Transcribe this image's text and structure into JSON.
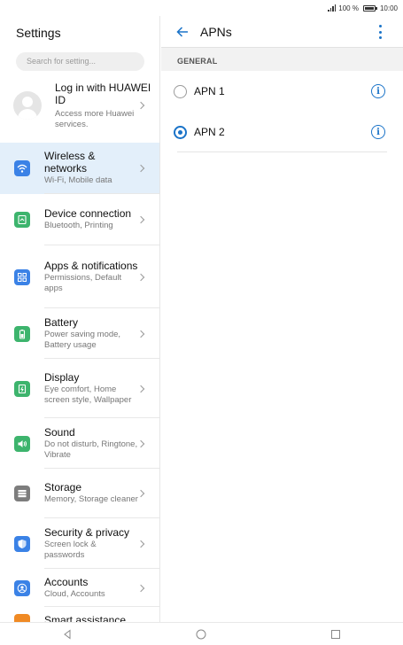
{
  "status_bar": {
    "battery_percent": "100 %",
    "time": "10:00"
  },
  "left_panel": {
    "title": "Settings",
    "search_placeholder": "Search for setting...",
    "account": {
      "title": "Log in with HUAWEI ID",
      "subtitle": "Access more Huawei services."
    },
    "items": [
      {
        "title": "Wireless & networks",
        "subtitle": "Wi-Fi, Mobile data",
        "icon": "wifi-icon",
        "color": "#3b82e6"
      },
      {
        "title": "Device connection",
        "subtitle": "Bluetooth, Printing",
        "icon": "device-connection-icon",
        "color": "#3db46d"
      },
      {
        "title": "Apps & notifications",
        "subtitle": "Permissions, Default apps",
        "icon": "apps-icon",
        "color": "#3b82e6"
      },
      {
        "title": "Battery",
        "subtitle": "Power saving mode, Battery usage",
        "icon": "battery-icon",
        "color": "#3db46d"
      },
      {
        "title": "Display",
        "subtitle": "Eye comfort, Home screen style, Wallpaper",
        "icon": "display-icon",
        "color": "#3db46d"
      },
      {
        "title": "Sound",
        "subtitle": "Do not disturb, Ringtone, Vibrate",
        "icon": "sound-icon",
        "color": "#3db46d"
      },
      {
        "title": "Storage",
        "subtitle": "Memory, Storage cleaner",
        "icon": "storage-icon",
        "color": "#7d7d7d"
      },
      {
        "title": "Security & privacy",
        "subtitle": "Screen lock & passwords",
        "icon": "shield-icon",
        "color": "#3b82e6"
      },
      {
        "title": "Accounts",
        "subtitle": "Cloud, Accounts",
        "icon": "account-icon",
        "color": "#3b82e6"
      },
      {
        "title": "Smart assistance",
        "subtitle": "",
        "icon": "smart-assistance-icon",
        "color": "#f08a24"
      }
    ]
  },
  "right_panel": {
    "title": "APNs",
    "section": "GENERAL",
    "apns": [
      {
        "name": "APN 1",
        "selected": false
      },
      {
        "name": "APN 2",
        "selected": true
      }
    ],
    "info_glyph": "i"
  },
  "colors": {
    "accent": "#1a73c8",
    "selected_row": "#e3effa"
  }
}
